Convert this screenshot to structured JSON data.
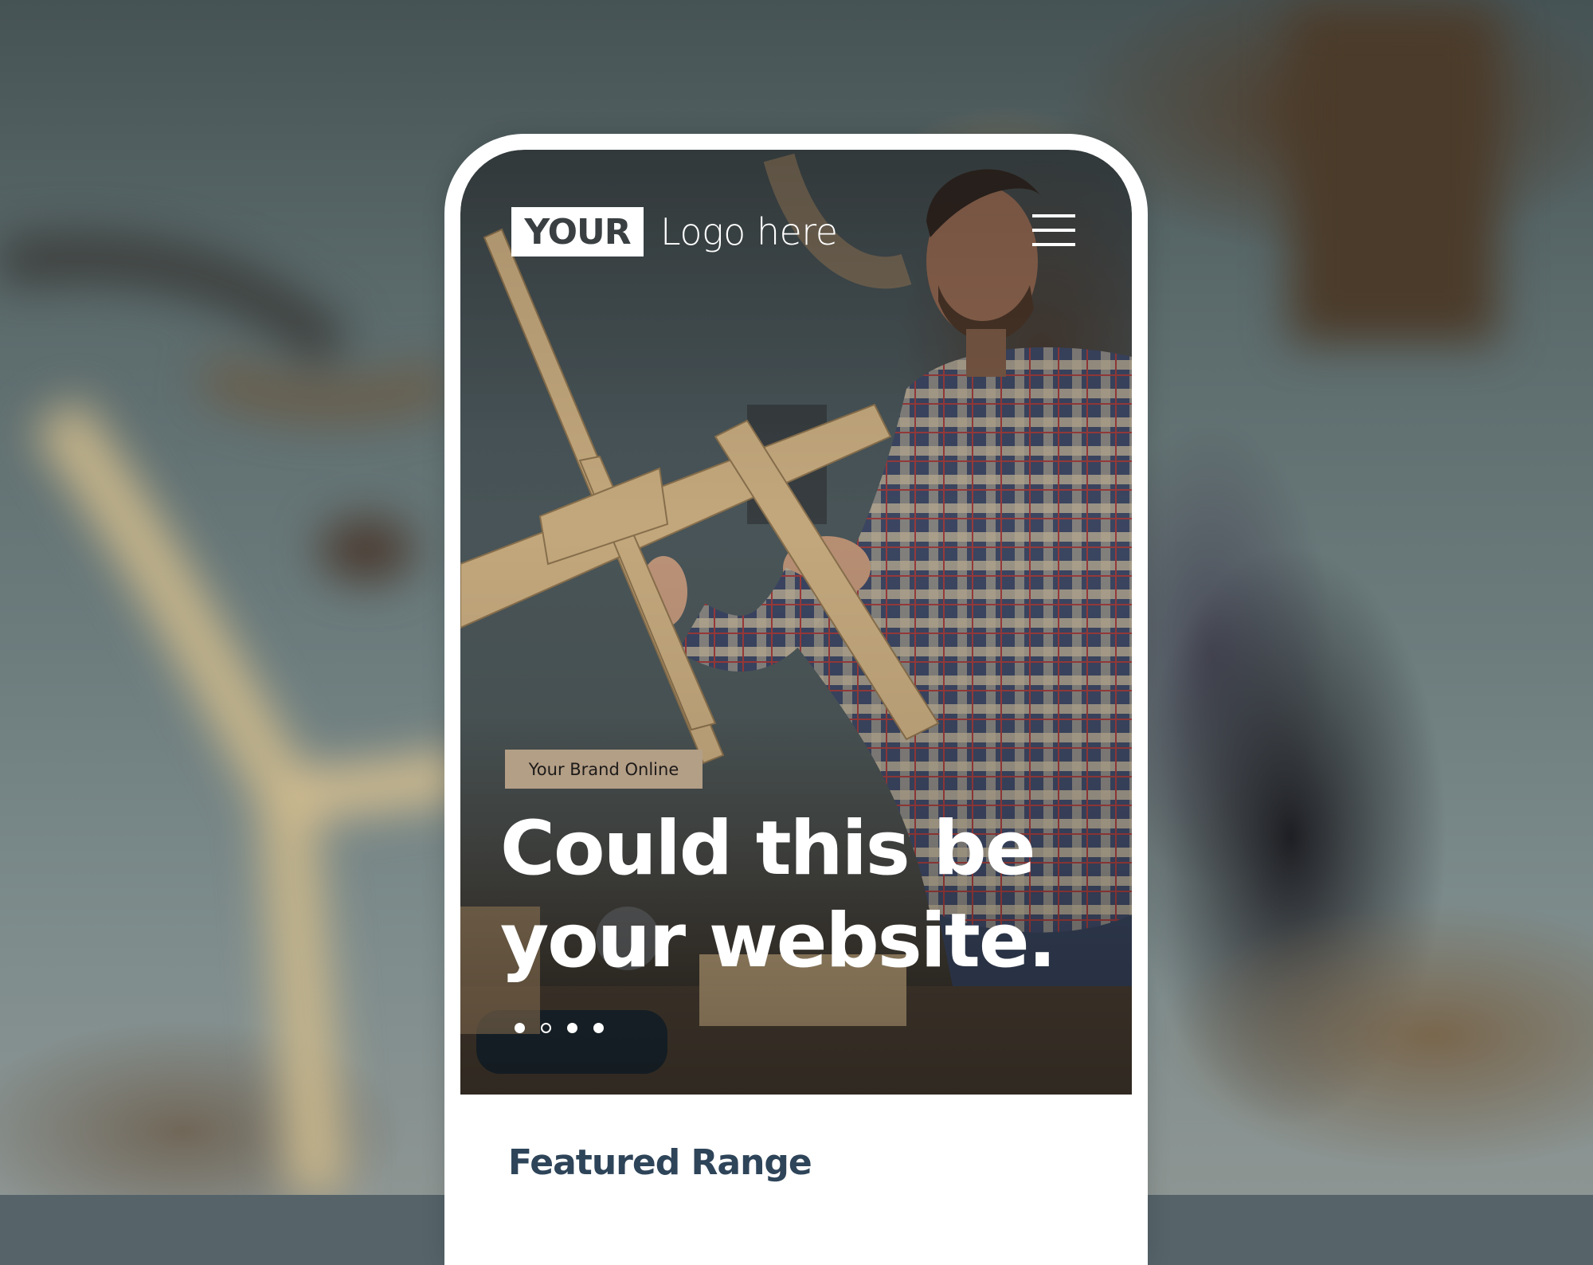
{
  "header": {
    "logo_mark": "YOUR",
    "logo_text": "Logo here",
    "menu_icon": "hamburger-menu-icon"
  },
  "hero": {
    "badge": "Your Brand Online",
    "headline_line1": "Could this be",
    "headline_line2": "your website.",
    "carousel": {
      "total_slides": 4,
      "active_slide": 2
    }
  },
  "sections": {
    "featured_title": "Featured Range"
  },
  "colors": {
    "badge_bg": "#b39e86",
    "heading_color": "#2e4459",
    "logo_text_color": "#3a3f42",
    "frame": "#ffffff"
  }
}
